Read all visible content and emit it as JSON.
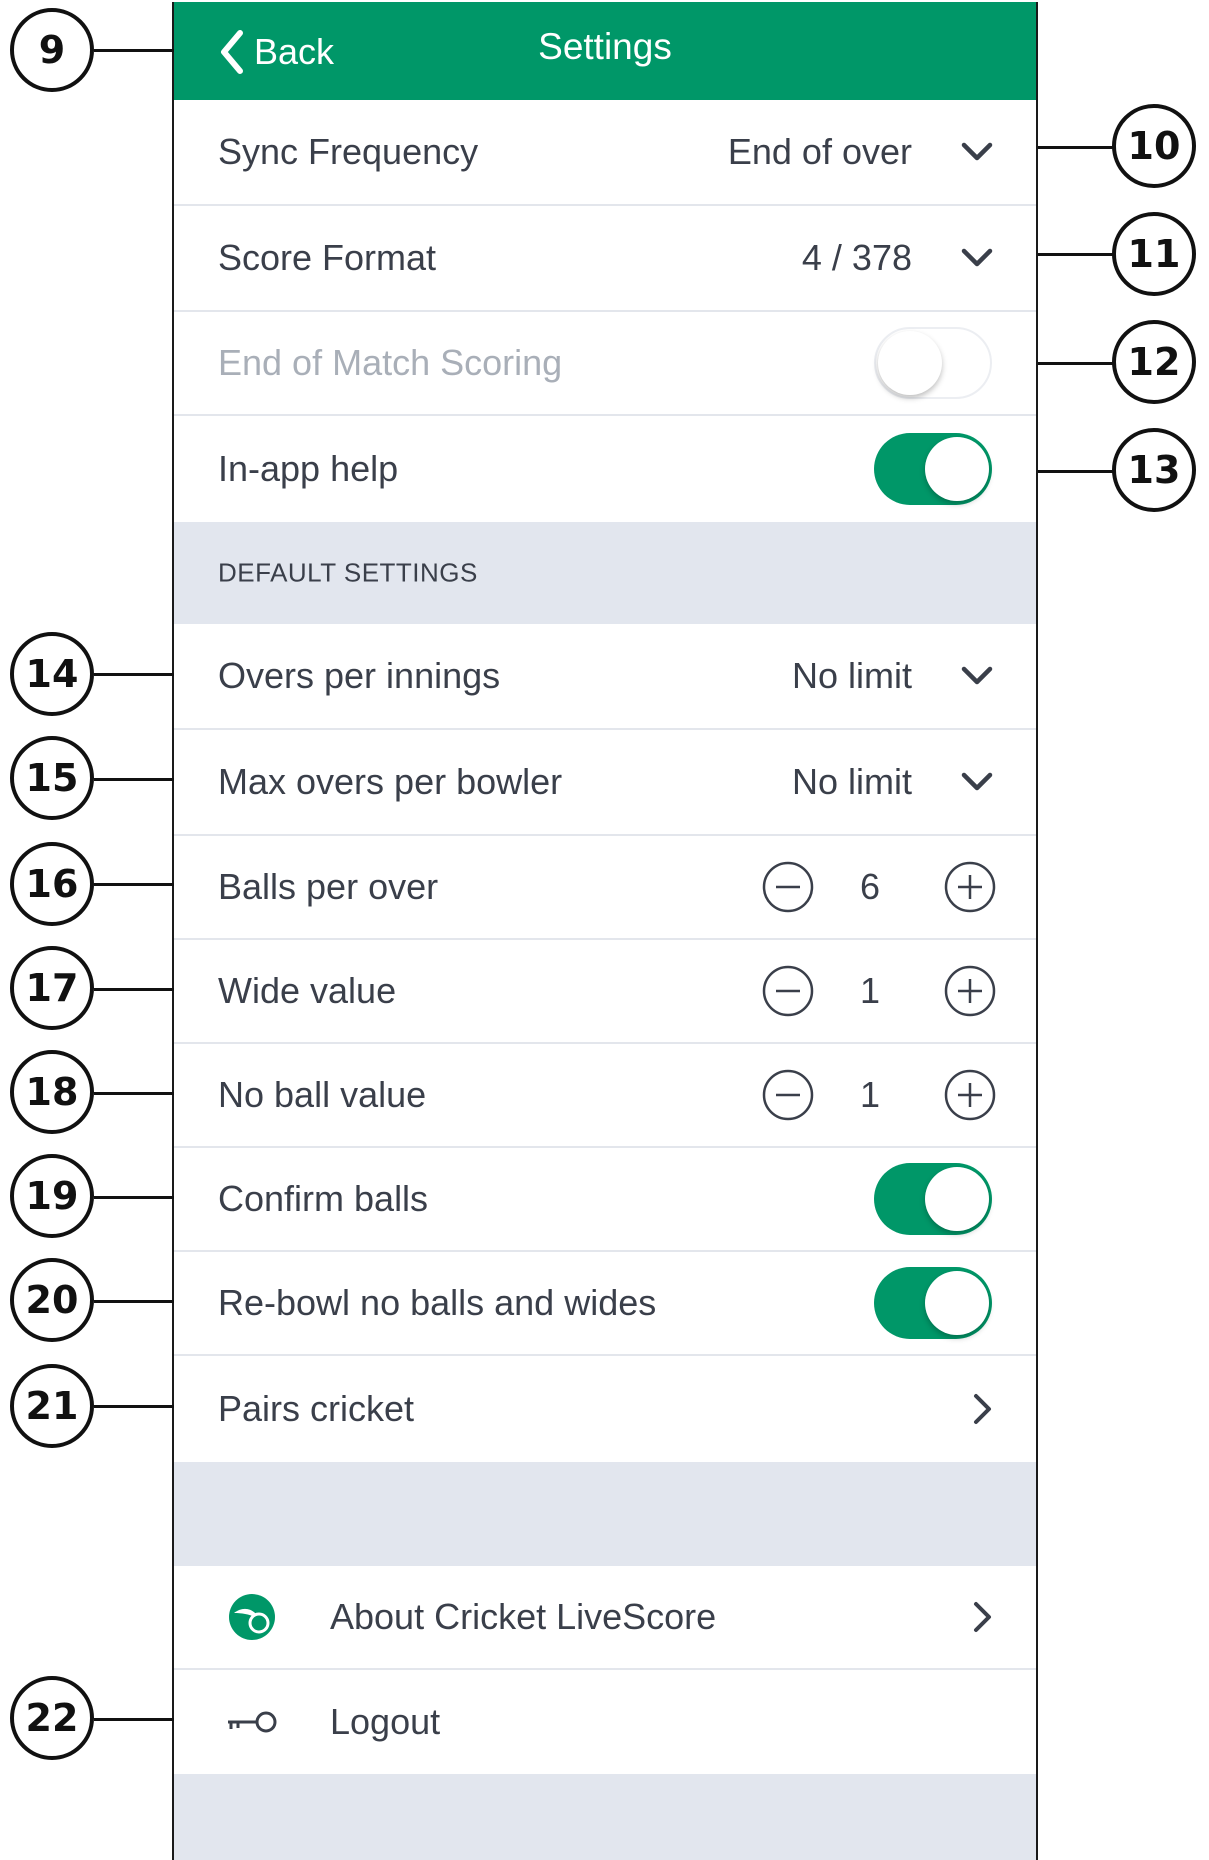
{
  "header": {
    "back_label": "Back",
    "title": "Settings"
  },
  "settings": {
    "sync_frequency": {
      "label": "Sync Frequency",
      "value": "End of over"
    },
    "score_format": {
      "label": "Score Format",
      "value": "4 / 378"
    },
    "end_of_match_scoring": {
      "label": "End of Match Scoring",
      "enabled": false,
      "disabled": true
    },
    "in_app_help": {
      "label": "In-app help",
      "enabled": true
    }
  },
  "default_settings": {
    "section_title": "DEFAULT SETTINGS",
    "overs_per_innings": {
      "label": "Overs per innings",
      "value": "No limit"
    },
    "max_overs_per_bowler": {
      "label": "Max overs per bowler",
      "value": "No limit"
    },
    "balls_per_over": {
      "label": "Balls per over",
      "value": "6"
    },
    "wide_value": {
      "label": "Wide value",
      "value": "1"
    },
    "no_ball_value": {
      "label": "No ball value",
      "value": "1"
    },
    "confirm_balls": {
      "label": "Confirm balls",
      "enabled": true
    },
    "rebowl": {
      "label": "Re-bowl no balls and wides",
      "enabled": true
    },
    "pairs_cricket": {
      "label": "Pairs cricket"
    }
  },
  "footer_items": {
    "about": {
      "label": "About Cricket LiveScore",
      "icon": "cricket-livescore-logo-icon"
    },
    "logout": {
      "label": "Logout",
      "icon": "key-icon"
    }
  },
  "callouts": [
    "9",
    "10",
    "11",
    "12",
    "13",
    "14",
    "15",
    "16",
    "17",
    "18",
    "19",
    "20",
    "21",
    "22"
  ],
  "colors": {
    "brand_green": "#009768",
    "background_gray": "#e2e6ee",
    "text": "#3a3f4a",
    "disabled_text": "#a9afb8"
  }
}
